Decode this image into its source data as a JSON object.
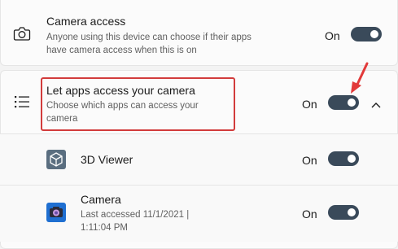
{
  "camera_access": {
    "title": "Camera access",
    "description": "Anyone using this device can choose if their apps have camera access when this is on",
    "state": "On",
    "icon": "camera-icon"
  },
  "let_apps": {
    "title": "Let apps access your camera",
    "description": "Choose which apps can access your camera",
    "state": "On",
    "icon": "list-icon",
    "highlight_color": "#d23c3c",
    "annotation_arrow_color": "#e23a3a"
  },
  "apps": [
    {
      "name": "3D Viewer",
      "state": "On",
      "icon": "cube-icon"
    },
    {
      "name": "Camera",
      "detail": "Last accessed 11/1/2021  |  1:11:04 PM",
      "state": "On",
      "icon": "camera-app-icon"
    }
  ],
  "colors": {
    "toggle_on": "#3a4a5a",
    "background": "#f3f3f3",
    "card": "#fbfbfb"
  }
}
